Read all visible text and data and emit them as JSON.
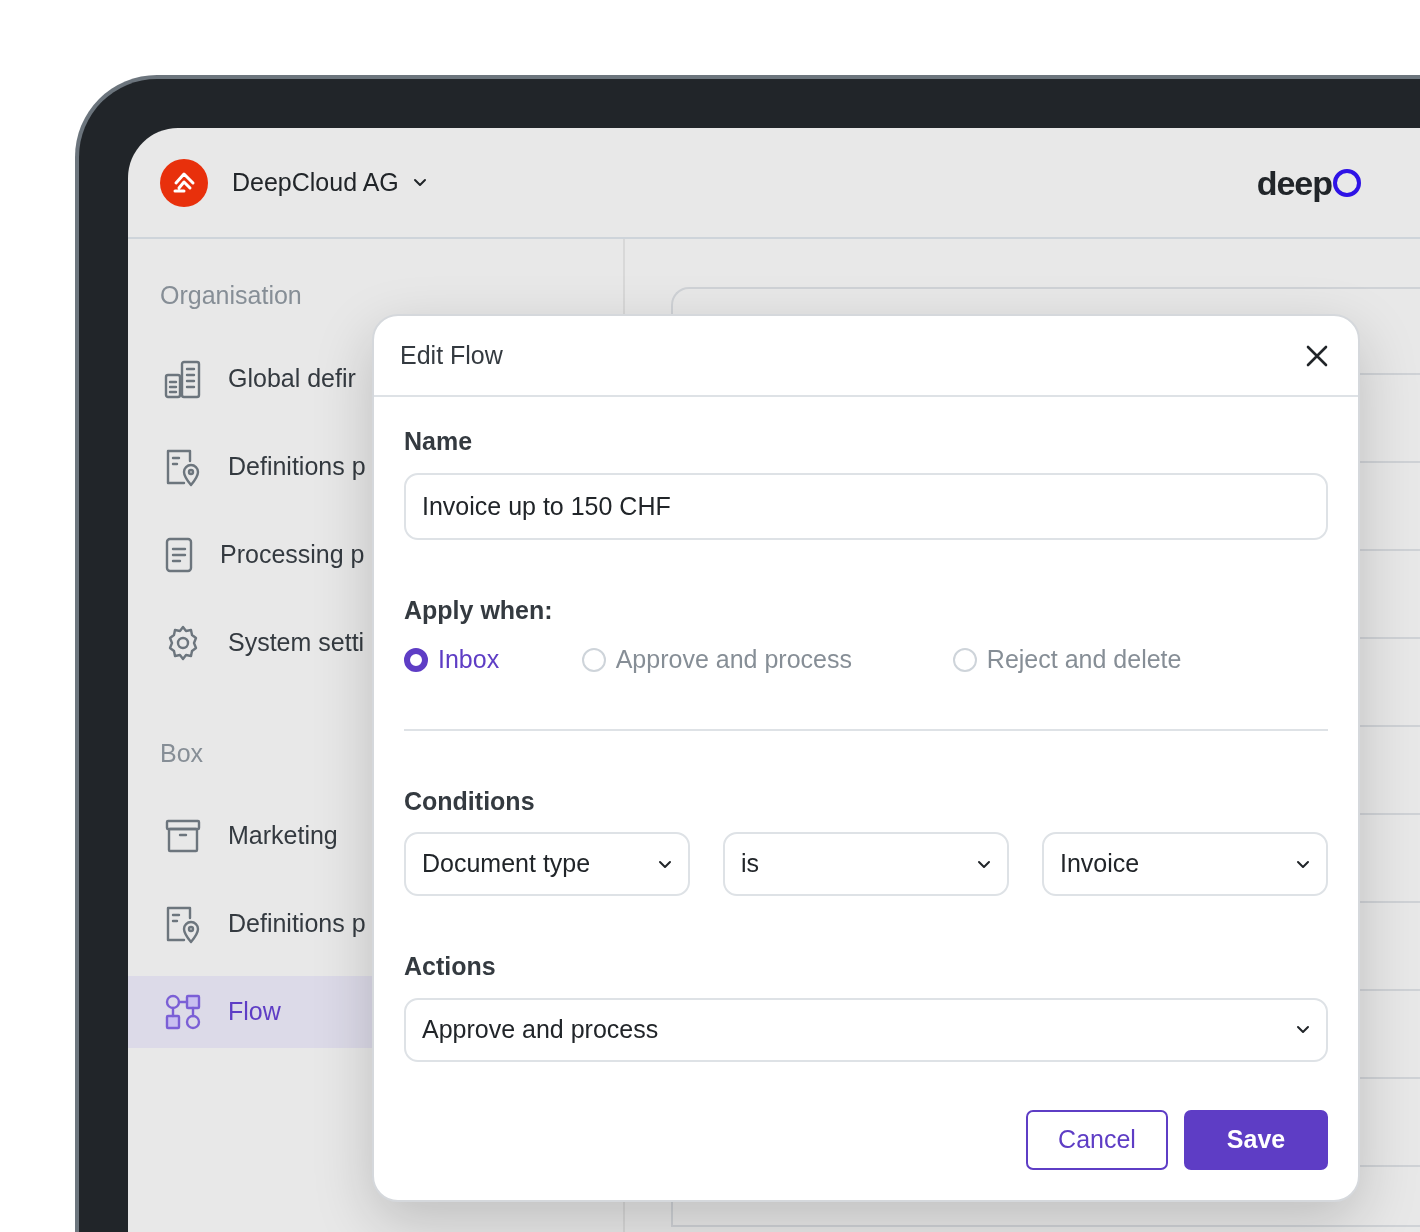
{
  "header": {
    "organisation": "DeepCloud AG",
    "brand": "deep"
  },
  "sidebar": {
    "sections": [
      {
        "title": "Organisation",
        "items": [
          {
            "label": "Global defir",
            "kind": "buildings",
            "selected": false
          },
          {
            "label": "Definitions p",
            "kind": "document-pin",
            "selected": false
          },
          {
            "label": "Processing p",
            "kind": "document",
            "selected": false
          },
          {
            "label": "System setti",
            "kind": "gear",
            "selected": false
          }
        ]
      },
      {
        "title": "Box",
        "items": [
          {
            "label": "Marketing",
            "kind": "archive",
            "selected": false
          },
          {
            "label": "Definitions p",
            "kind": "document-pin",
            "selected": false
          },
          {
            "label": "Flow",
            "kind": "flow",
            "selected": true
          }
        ]
      }
    ]
  },
  "modal": {
    "title": "Edit Flow",
    "name_label": "Name",
    "name_value": "Invoice up to 150 CHF",
    "apply_label": "Apply when:",
    "options": [
      {
        "label": "Inbox",
        "selected": true
      },
      {
        "label": "Approve and process",
        "selected": false
      },
      {
        "label": "Reject and delete",
        "selected": false
      }
    ],
    "conditions_label": "Conditions",
    "conditions": [
      "Document type",
      "is",
      "Invoice"
    ],
    "actions_label": "Actions",
    "action": "Approve and process",
    "buttons": [
      {
        "label": "Cancel",
        "kind": "secondary"
      },
      {
        "label": "Save",
        "kind": "primary"
      }
    ]
  }
}
